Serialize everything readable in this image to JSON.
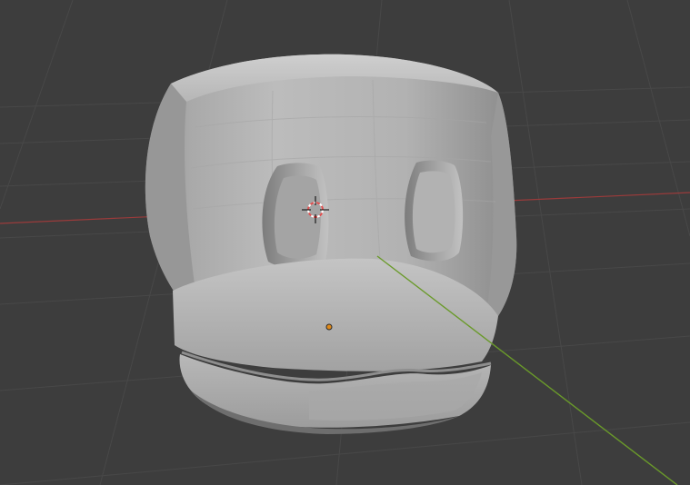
{
  "viewport": {
    "background_color": "#3d3d3d",
    "grid_color": "#4a4a4a",
    "x_axis_color": "#9a3b3b",
    "y_axis_color": "#6a9a2a"
  },
  "scene": {
    "object": {
      "shape": "sculpted-head-mesh",
      "base_color": "#b4b4b4",
      "shadow_color": "#8a8a8a",
      "highlight_color": "#d4d4d4",
      "eye_socket_color": "#9a9a9a"
    },
    "origin_marker_color": "#e08a1a",
    "cursor_icon": "3d-cursor-icon",
    "cursor_colors": {
      "ring_red": "#e05050",
      "ring_white": "#ffffff",
      "crosshair": "#000000"
    }
  }
}
